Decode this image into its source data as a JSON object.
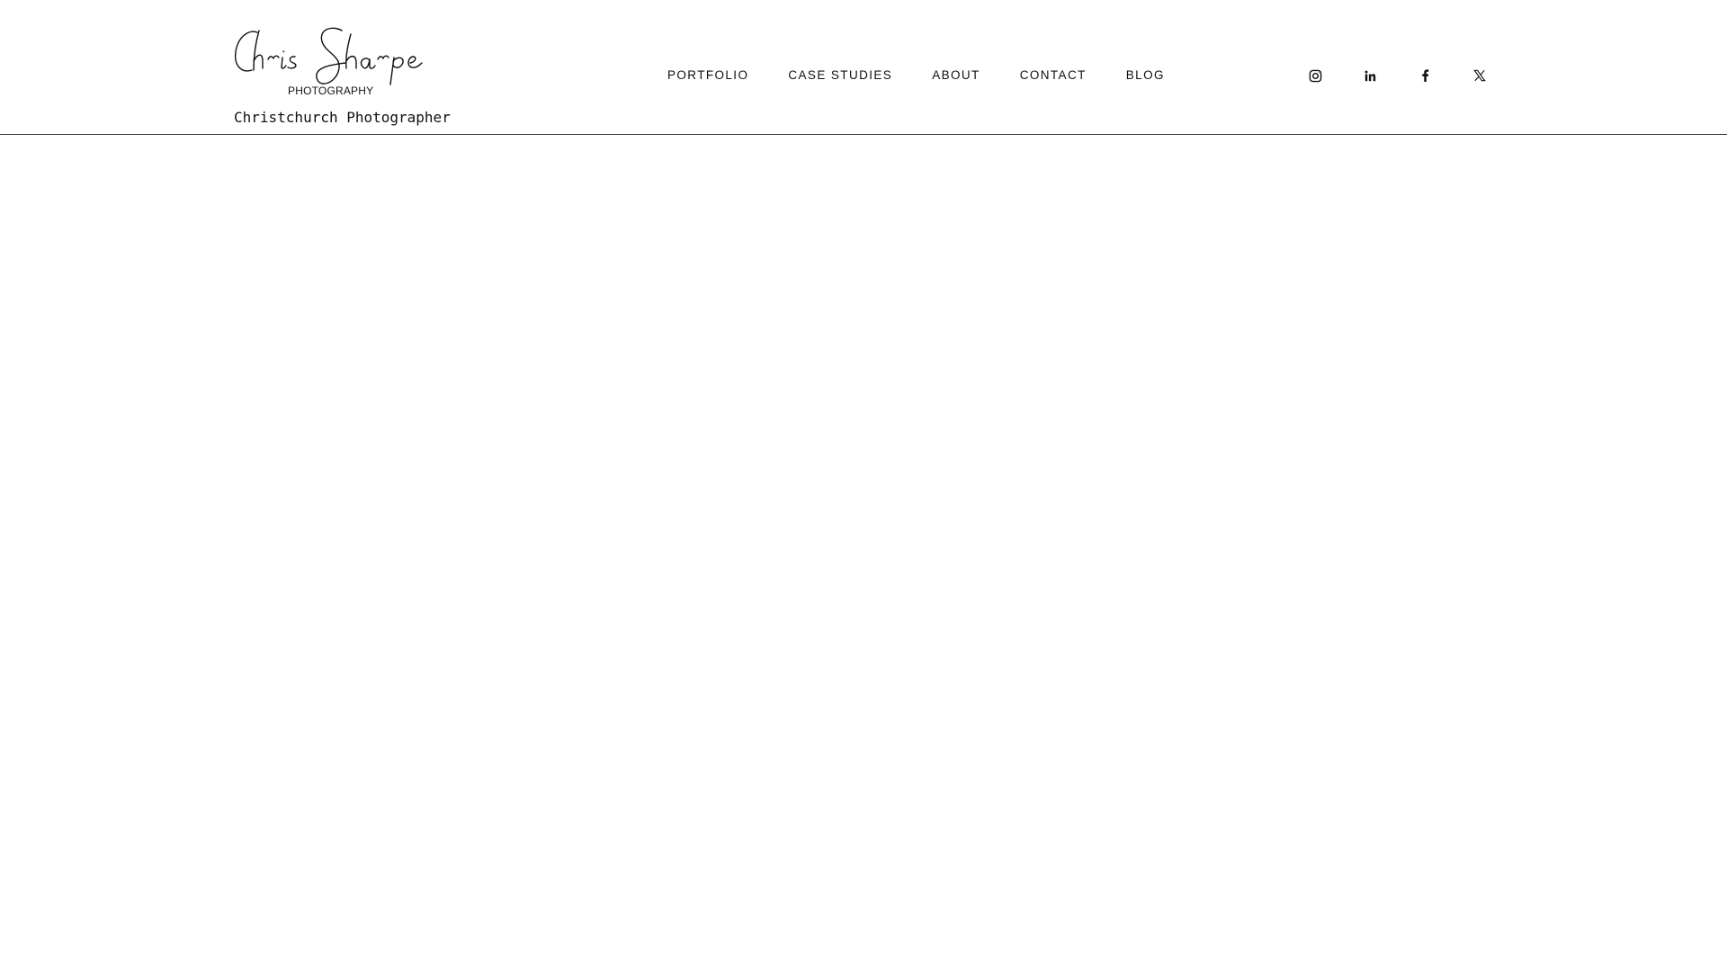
{
  "brand": {
    "logo_script": "Chris Sharpe",
    "logo_sub": "PHOTOGRAPHY",
    "tagline": "Christchurch Photographer"
  },
  "nav": {
    "items": [
      {
        "label": "PORTFOLIO"
      },
      {
        "label": "CASE STUDIES"
      },
      {
        "label": "ABOUT"
      },
      {
        "label": "CONTACT"
      },
      {
        "label": "BLOG"
      }
    ]
  },
  "social": {
    "icons": [
      "instagram-icon",
      "linkedin-icon",
      "facebook-icon",
      "x-icon"
    ]
  },
  "colors": {
    "background": "#ffffff",
    "text": "#111111",
    "divider": "#333333"
  }
}
